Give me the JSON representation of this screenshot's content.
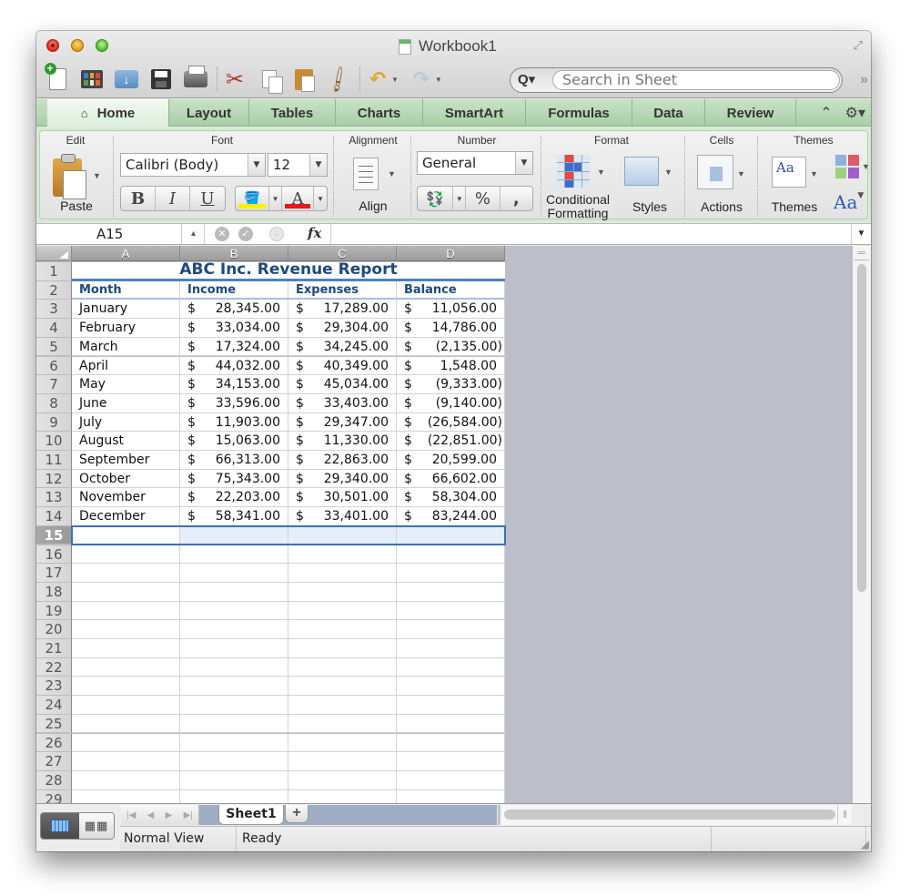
{
  "window": {
    "title": "Workbook1"
  },
  "toolbar": {
    "icons": [
      "new-icon",
      "gallery-icon",
      "open-icon",
      "save-icon",
      "print-icon",
      "cut-icon",
      "copy-icon",
      "paste-icon",
      "format-painter-icon",
      "undo-icon",
      "redo-icon"
    ],
    "search_placeholder": "Search in Sheet"
  },
  "ribbon_tabs": [
    {
      "label": "Home",
      "active": true
    },
    {
      "label": "Layout"
    },
    {
      "label": "Tables"
    },
    {
      "label": "Charts"
    },
    {
      "label": "SmartArt"
    },
    {
      "label": "Formulas"
    },
    {
      "label": "Data"
    },
    {
      "label": "Review"
    }
  ],
  "ribbon": {
    "groups": {
      "edit": "Edit",
      "font": "Font",
      "alignment": "Alignment",
      "number": "Number",
      "format": "Format",
      "cells": "Cells",
      "themes": "Themes"
    },
    "paste_label": "Paste",
    "font_name": "Calibri (Body)",
    "font_size": "12",
    "bold": "B",
    "italic": "I",
    "underline": "U",
    "font_color_glyph": "A",
    "fill_color": "#ffef00",
    "font_color": "#e8161c",
    "align_label": "Align",
    "number_format": "General",
    "percent": "%",
    "comma": ",",
    "conditional_formatting_label": "Conditional\nFormatting",
    "conditional_formatting_line1": "Conditional",
    "conditional_formatting_line2": "Formatting",
    "styles_label": "Styles",
    "actions_label": "Actions",
    "themes_label": "Themes",
    "theme_sample": "Aa",
    "fonts_sample": "Aa"
  },
  "formula_bar": {
    "name_box": "A15",
    "fx": "fx",
    "value": ""
  },
  "sheet": {
    "columns": [
      "A",
      "B",
      "C",
      "D"
    ],
    "title": "ABC Inc. Revenue Report",
    "headers": [
      "Month",
      "Income",
      "Expenses",
      "Balance"
    ],
    "rows": [
      {
        "month": "January",
        "income": "28,345.00",
        "expenses": "17,289.00",
        "balance": "11,056.00"
      },
      {
        "month": "February",
        "income": "33,034.00",
        "expenses": "29,304.00",
        "balance": "14,786.00"
      },
      {
        "month": "March",
        "income": "17,324.00",
        "expenses": "34,245.00",
        "balance": "(2,135.00)"
      },
      {
        "month": "April",
        "income": "44,032.00",
        "expenses": "40,349.00",
        "balance": "1,548.00"
      },
      {
        "month": "May",
        "income": "34,153.00",
        "expenses": "45,034.00",
        "balance": "(9,333.00)"
      },
      {
        "month": "June",
        "income": "33,596.00",
        "expenses": "33,403.00",
        "balance": "(9,140.00)"
      },
      {
        "month": "July",
        "income": "11,903.00",
        "expenses": "29,347.00",
        "balance": "(26,584.00)"
      },
      {
        "month": "August",
        "income": "15,063.00",
        "expenses": "11,330.00",
        "balance": "(22,851.00)"
      },
      {
        "month": "September",
        "income": "66,313.00",
        "expenses": "22,863.00",
        "balance": "20,599.00"
      },
      {
        "month": "October",
        "income": "75,343.00",
        "expenses": "29,340.00",
        "balance": "66,602.00"
      },
      {
        "month": "November",
        "income": "22,203.00",
        "expenses": "30,501.00",
        "balance": "58,304.00"
      },
      {
        "month": "December",
        "income": "58,341.00",
        "expenses": "33,401.00",
        "balance": "83,244.00"
      }
    ],
    "currency_symbol": "$",
    "selected_row": 15,
    "visible_row_count": 29,
    "accent_color": "#1f497d",
    "title_border_color": "#4f81bd"
  },
  "sheet_tabs": {
    "tabs": [
      "Sheet1"
    ],
    "add_label": "+"
  },
  "status_bar": {
    "view": "Normal View",
    "status": "Ready"
  }
}
